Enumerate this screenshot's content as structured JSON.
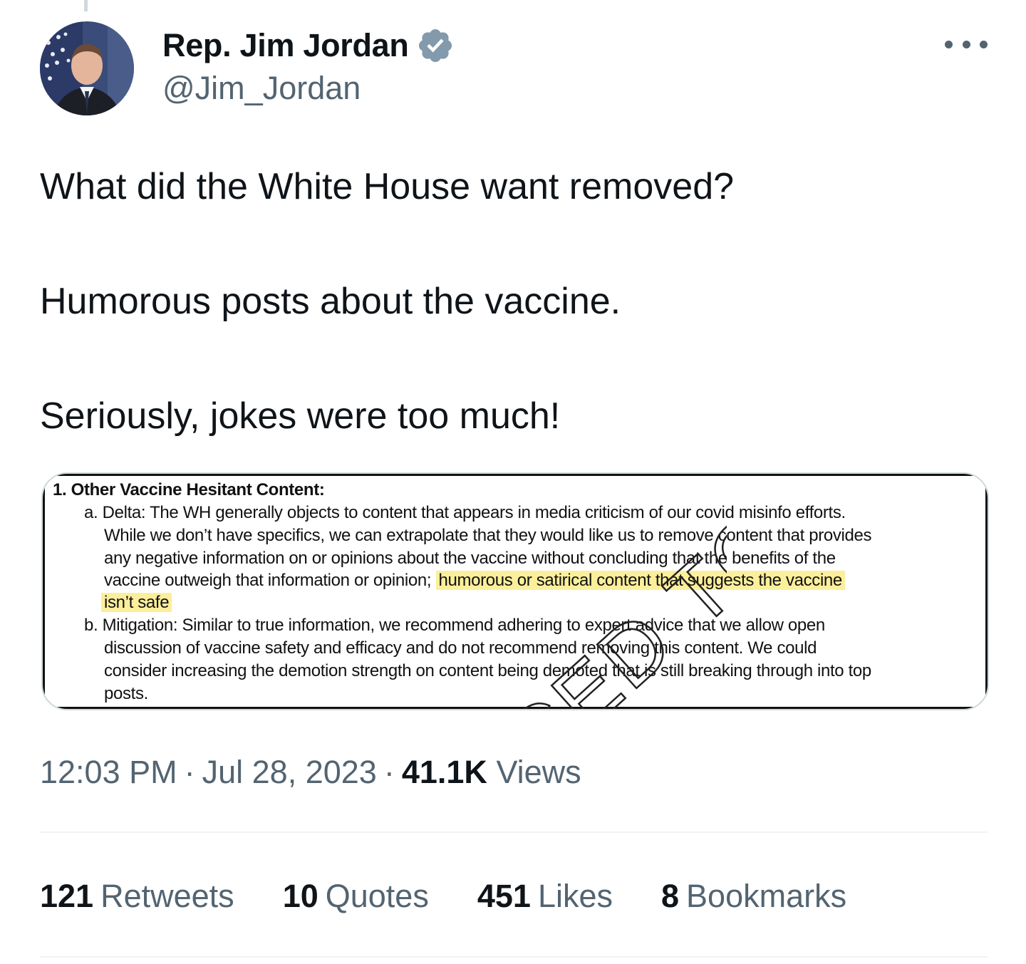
{
  "author": {
    "display_name": "Rep. Jim Jordan",
    "handle": "@Jim_Jordan",
    "verified": true,
    "verified_color": "#829aab"
  },
  "tweet": {
    "lines": [
      "What did the White House want removed?",
      "Humorous posts about the vaccine.",
      "Seriously, jokes were too much!"
    ]
  },
  "document": {
    "heading": "1. Other Vaccine Hesitant Content:",
    "item_a_lines": [
      "a. Delta:  The WH generally objects to content that appears in media criticism of our covid misinfo efforts.",
      "While we don’t have specifics, we can extrapolate that they would like us to remove content that provides",
      "any negative information on or opinions about the vaccine without concluding that the benefits of the",
      "vaccine outweigh that information or opinion;"
    ],
    "highlight_line_1": "humorous or satirical content that suggests the vaccine",
    "highlight_line_2": "isn’t safe",
    "item_b_lines": [
      "b. Mitigation:  Similar to true information, we recommend adhering to expert advice that we allow open",
      "discussion of vaccine safety and efficacy and do not recommend removing this content.  We could",
      "consider increasing the demotion strength on content being demoted that is still breaking through into top",
      "posts."
    ],
    "stamp_text": "CED TO",
    "highlight_color": "#fbef9b"
  },
  "meta": {
    "time": "12:03 PM",
    "separator": "·",
    "date": "Jul 28, 2023",
    "views_count": "41.1K",
    "views_label": "Views"
  },
  "stats": [
    {
      "count": "121",
      "label": "Retweets"
    },
    {
      "count": "10",
      "label": "Quotes"
    },
    {
      "count": "451",
      "label": "Likes"
    },
    {
      "count": "8",
      "label": "Bookmarks"
    }
  ],
  "icons": {
    "verified": "verified-badge-icon",
    "more": "more-options-icon"
  }
}
